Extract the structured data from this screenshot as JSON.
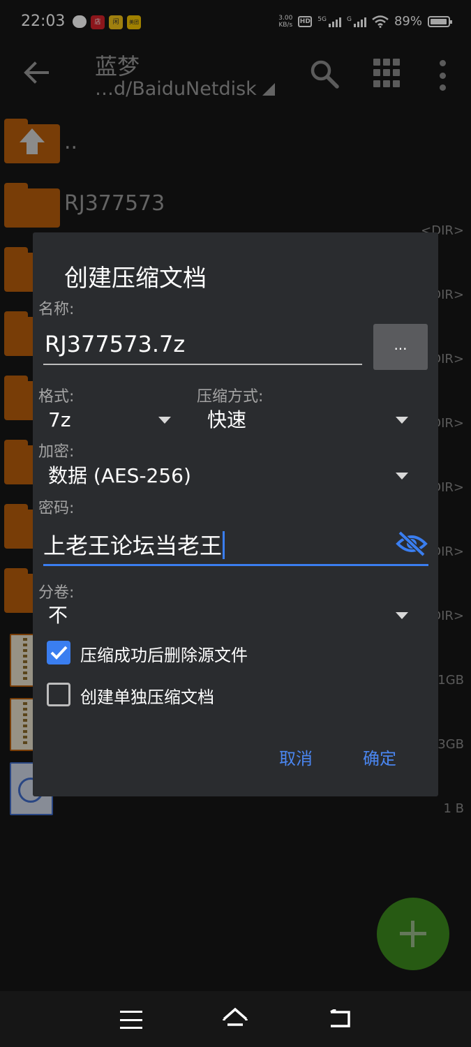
{
  "status_bar": {
    "time": "22:03",
    "speed_value": "3.00",
    "speed_unit": "KB/s",
    "hd_label": "HD",
    "signal1_label": "5G",
    "signal2_label": "G",
    "battery_percent": "89%",
    "app_icons": [
      {
        "name": "message-icon",
        "label": ""
      },
      {
        "name": "store-icon",
        "label": "店"
      },
      {
        "name": "app-icon",
        "label": "闲"
      },
      {
        "name": "meituan-icon",
        "label": "美团"
      }
    ]
  },
  "toolbar": {
    "title": "蓝梦",
    "path": "…d/BaiduNetdisk"
  },
  "file_list": {
    "parent_label": "..",
    "items": [
      {
        "name": "RJ377573",
        "meta": "<DIR>"
      },
      {
        "name": "",
        "meta": "DIR>"
      },
      {
        "name": "",
        "meta": "DIR>"
      },
      {
        "name": "",
        "meta": "DIR>"
      },
      {
        "name": "",
        "meta": "DIR>"
      },
      {
        "name": "",
        "meta": "DIR>"
      },
      {
        "name": "",
        "meta": "DIR>"
      },
      {
        "name": "",
        "meta": "1GB"
      },
      {
        "name": "",
        "meta": "3GB"
      },
      {
        "name": "",
        "meta": "1 B"
      }
    ]
  },
  "dialog": {
    "title": "创建压缩文档",
    "name_label": "名称:",
    "name_value": "RJ377573.7z",
    "browse_label": "...",
    "format_label": "格式:",
    "format_value": "7z",
    "method_label": "压缩方式:",
    "method_value": "快速",
    "encrypt_label": "加密:",
    "encrypt_value": "数据 (AES-256)",
    "password_label": "密码:",
    "password_value": "上老王论坛当老王",
    "split_label": "分卷:",
    "split_value": "不",
    "checkbox_delete": {
      "label": "压缩成功后删除源文件",
      "checked": true
    },
    "checkbox_separate": {
      "label": "创建单独压缩文档",
      "checked": false
    },
    "cancel_label": "取消",
    "ok_label": "确定"
  },
  "colors": {
    "accent": "#3a7ef0",
    "folder": "#b85e0c",
    "fab": "#3d8a1e",
    "dialog_bg": "#2a2c2f"
  }
}
